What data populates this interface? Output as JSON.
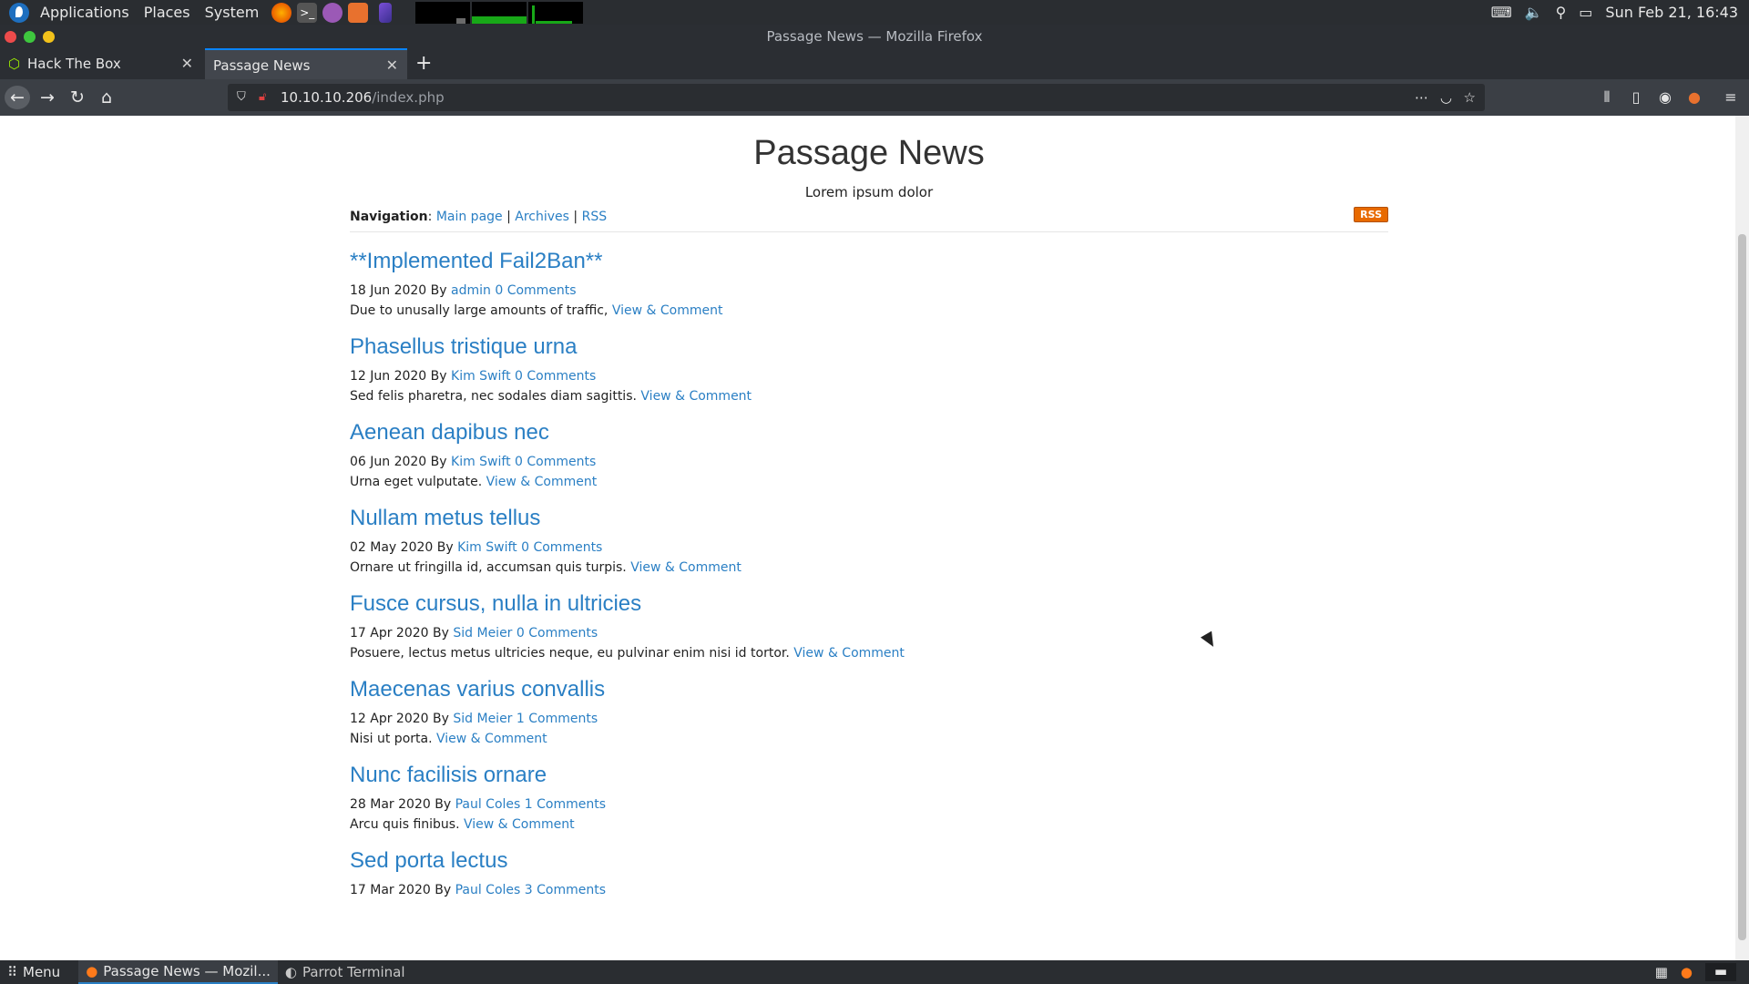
{
  "system_panel": {
    "menus": [
      "Applications",
      "Places",
      "System"
    ],
    "clock": "Sun Feb 21, 16:43"
  },
  "window": {
    "title": "Passage News — Mozilla Firefox"
  },
  "tabs": [
    {
      "label": "Hack The Box"
    },
    {
      "label": "Passage News"
    }
  ],
  "urlbar": {
    "host": "10.10.10.206",
    "path": "/index.php"
  },
  "site": {
    "title": "Passage News",
    "tagline": "Lorem ipsum dolor",
    "nav_label": "Navigation",
    "nav_links": [
      "Main page",
      "Archives",
      "RSS"
    ],
    "rss_badge": "RSS"
  },
  "posts": [
    {
      "title": "**Implemented Fail2Ban**",
      "date": "18 Jun 2020",
      "author": "admin",
      "comments": "0 Comments",
      "excerpt": "Due to unusally large amounts of traffic,",
      "link": "View & Comment"
    },
    {
      "title": "Phasellus tristique urna",
      "date": "12 Jun 2020",
      "author": "Kim Swift",
      "comments": "0 Comments",
      "excerpt": "Sed felis pharetra, nec sodales diam sagittis.",
      "link": "View & Comment"
    },
    {
      "title": "Aenean dapibus nec",
      "date": "06 Jun 2020",
      "author": "Kim Swift",
      "comments": "0 Comments",
      "excerpt": "Urna eget vulputate.",
      "link": "View & Comment"
    },
    {
      "title": "Nullam metus tellus",
      "date": "02 May 2020",
      "author": "Kim Swift",
      "comments": "0 Comments",
      "excerpt": "Ornare ut fringilla id, accumsan quis turpis.",
      "link": "View & Comment"
    },
    {
      "title": "Fusce cursus, nulla in ultricies",
      "date": "17 Apr 2020",
      "author": "Sid Meier",
      "comments": "0 Comments",
      "excerpt": "Posuere, lectus metus ultricies neque, eu pulvinar enim nisi id tortor.",
      "link": "View & Comment"
    },
    {
      "title": "Maecenas varius convallis",
      "date": "12 Apr 2020",
      "author": "Sid Meier",
      "comments": "1 Comments",
      "excerpt": "Nisi ut porta.",
      "link": "View & Comment"
    },
    {
      "title": "Nunc facilisis ornare",
      "date": "28 Mar 2020",
      "author": "Paul Coles",
      "comments": "1 Comments",
      "excerpt": "Arcu quis finibus.",
      "link": "View & Comment"
    },
    {
      "title": "Sed porta lectus",
      "date": "17 Mar 2020",
      "author": "Paul Coles",
      "comments": "3 Comments",
      "excerpt": "",
      "link": ""
    }
  ],
  "meta_by": "By",
  "taskbar": {
    "menu": "Menu",
    "tasks": [
      "Passage News — Mozil...",
      "Parrot Terminal"
    ]
  }
}
